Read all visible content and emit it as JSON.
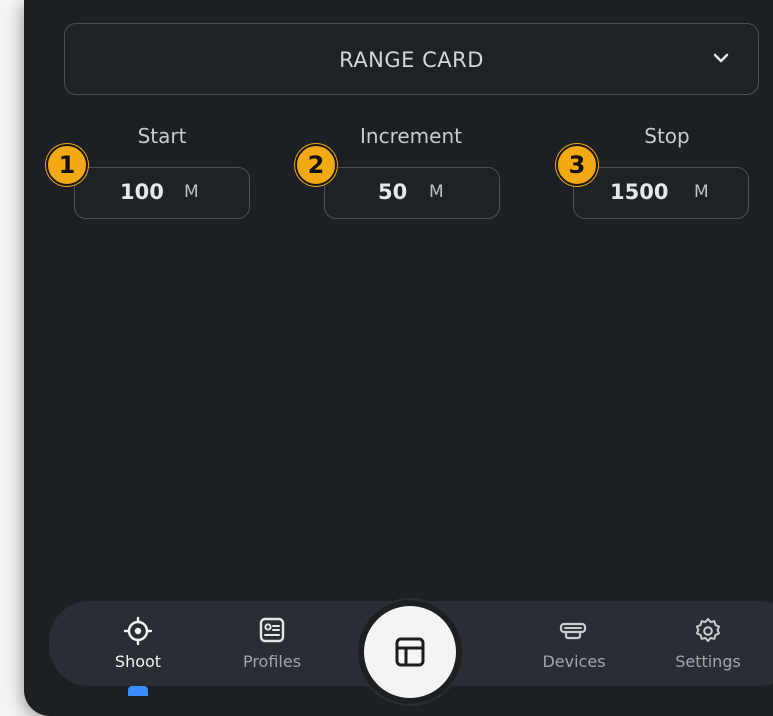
{
  "header": {
    "title": "RANGE CARD",
    "dropdown_icon": "chevron-down-icon"
  },
  "fields": [
    {
      "badge": "1",
      "label": "Start",
      "value": "100",
      "unit": "M"
    },
    {
      "badge": "2",
      "label": "Increment",
      "value": "50",
      "unit": "M"
    },
    {
      "badge": "3",
      "label": "Stop",
      "value": "1500",
      "unit": "M"
    }
  ],
  "nav": {
    "items": [
      {
        "label": "Shoot",
        "icon": "crosshair-icon",
        "active": true
      },
      {
        "label": "Profiles",
        "icon": "profile-card-icon",
        "active": false
      },
      {
        "label": "Devices",
        "icon": "device-icon",
        "active": false
      },
      {
        "label": "Settings",
        "icon": "gear-icon",
        "active": false
      }
    ],
    "center_icon": "table-icon"
  },
  "colors": {
    "background": "#1c1f23",
    "badge": "#f2a913",
    "active_indicator": "#3b8cff",
    "navbar": "#2a2e34"
  }
}
